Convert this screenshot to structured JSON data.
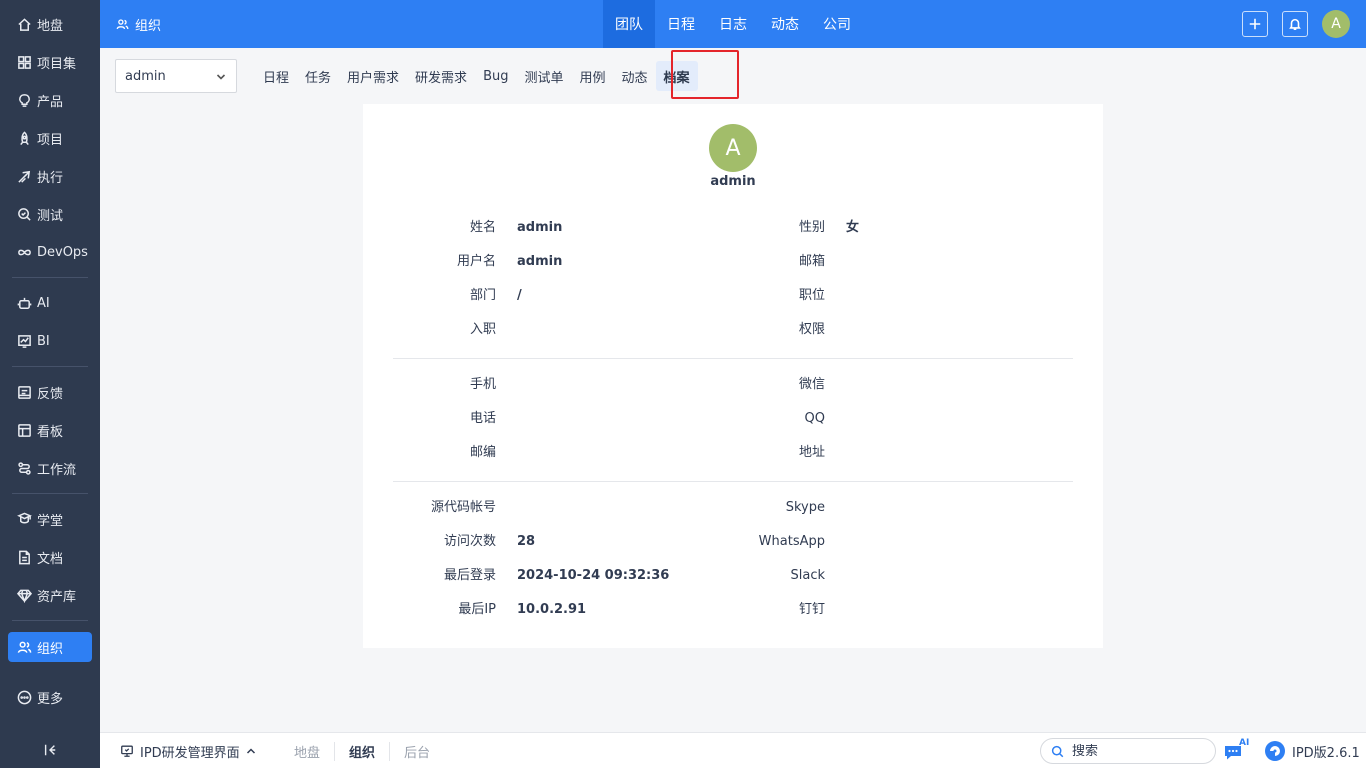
{
  "sidebar": {
    "items": [
      {
        "label": "地盘",
        "icon": "home-icon"
      },
      {
        "label": "项目集",
        "icon": "grid-icon"
      },
      {
        "label": "产品",
        "icon": "lightbulb-icon"
      },
      {
        "label": "项目",
        "icon": "rocket-icon"
      },
      {
        "label": "执行",
        "icon": "run-icon"
      },
      {
        "label": "测试",
        "icon": "magnifier-check-icon"
      },
      {
        "label": "DevOps",
        "icon": "infinity-icon"
      },
      {
        "label": "AI",
        "icon": "robot-icon"
      },
      {
        "label": "BI",
        "icon": "chart-icon"
      },
      {
        "label": "反馈",
        "icon": "feedback-icon"
      },
      {
        "label": "看板",
        "icon": "kanban-icon"
      },
      {
        "label": "工作流",
        "icon": "workflow-icon"
      },
      {
        "label": "学堂",
        "icon": "school-icon"
      },
      {
        "label": "文档",
        "icon": "document-icon"
      },
      {
        "label": "资产库",
        "icon": "diamond-icon"
      },
      {
        "label": "组织",
        "icon": "users-icon"
      },
      {
        "label": "更多",
        "icon": "more-icon"
      }
    ]
  },
  "header": {
    "title": "组织",
    "tabs": [
      "团队",
      "日程",
      "日志",
      "动态",
      "公司"
    ],
    "avatar_initial": "A"
  },
  "toolbar": {
    "user_select": "admin",
    "tabs": [
      "日程",
      "任务",
      "用户需求",
      "研发需求",
      "Bug",
      "测试单",
      "用例",
      "动态",
      "档案"
    ]
  },
  "profile": {
    "avatar_initial": "A",
    "name": "admin",
    "left": [
      {
        "label": "姓名",
        "value": "admin"
      },
      {
        "label": "用户名",
        "value": "admin"
      },
      {
        "label": "部门",
        "value": "/"
      },
      {
        "label": "入职",
        "value": ""
      },
      {
        "label": "手机",
        "value": ""
      },
      {
        "label": "电话",
        "value": ""
      },
      {
        "label": "邮编",
        "value": ""
      },
      {
        "label": "源代码帐号",
        "value": ""
      },
      {
        "label": "访问次数",
        "value": "28"
      },
      {
        "label": "最后登录",
        "value": "2024-10-24 09:32:36"
      },
      {
        "label": "最后IP",
        "value": "10.0.2.91"
      }
    ],
    "right": [
      {
        "label": "性别",
        "value": "女"
      },
      {
        "label": "邮箱",
        "value": ""
      },
      {
        "label": "职位",
        "value": ""
      },
      {
        "label": "权限",
        "value": ""
      },
      {
        "label": "微信",
        "value": ""
      },
      {
        "label": "QQ",
        "value": ""
      },
      {
        "label": "地址",
        "value": ""
      },
      {
        "label": "Skype",
        "value": ""
      },
      {
        "label": "WhatsApp",
        "value": ""
      },
      {
        "label": "Slack",
        "value": ""
      },
      {
        "label": "钉钉",
        "value": ""
      }
    ]
  },
  "footer": {
    "env_label": "IPD研发管理界面",
    "crumbs": [
      "地盘",
      "组织",
      "后台"
    ],
    "search_placeholder": "搜索",
    "ai_label": "AI",
    "version": "IPD版2.6.1"
  },
  "colors": {
    "primary": "#2e7ff3",
    "sidebar_bg": "#2e3a4f",
    "avatar": "#a2bd6a",
    "highlight": "#e4252b"
  }
}
